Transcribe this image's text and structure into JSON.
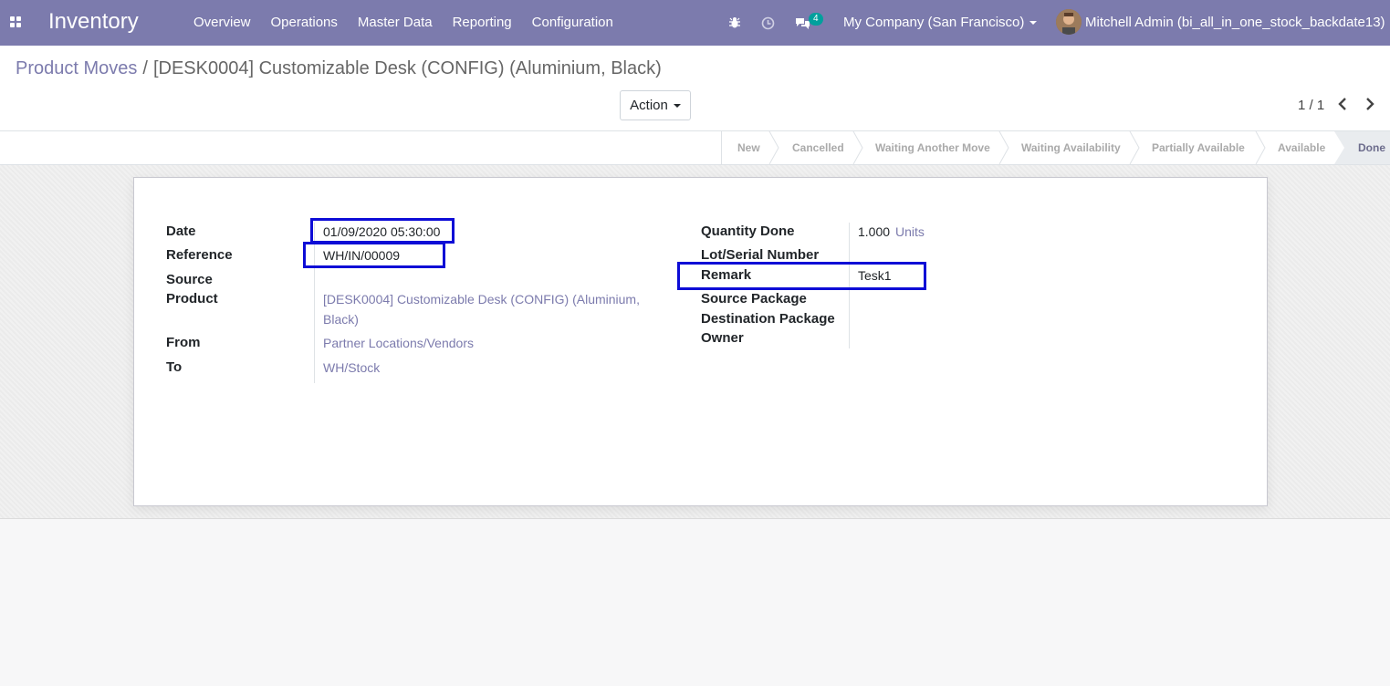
{
  "navbar": {
    "app_name": "Inventory",
    "menu": [
      "Overview",
      "Operations",
      "Master Data",
      "Reporting",
      "Configuration"
    ],
    "messages_count": "4",
    "company": "My Company (San Francisco)",
    "user": "Mitchell Admin (bi_all_in_one_stock_backdate13)",
    "bg_color": "#7c7bad"
  },
  "control": {
    "breadcrumb_parent": "Product Moves",
    "breadcrumb_separator": "/",
    "breadcrumb_current": "[DESK0004] Customizable Desk (CONFIG) (Aluminium, Black)",
    "action_label": "Action",
    "pager": "1 / 1"
  },
  "statusbar": {
    "stages": [
      "New",
      "Cancelled",
      "Waiting Another Move",
      "Waiting Availability",
      "Partially Available",
      "Available",
      "Done"
    ],
    "active": "Done"
  },
  "form": {
    "left": {
      "date_label": "Date",
      "date_value": "01/09/2020 05:30:00",
      "reference_label": "Reference",
      "reference_value": "WH/IN/00009",
      "source_label": "Source",
      "product_label": "Product",
      "product_value_line1": "[DESK0004] Customizable Desk (CONFIG) (Aluminium,",
      "product_value_line2": "Black)",
      "from_label": "From",
      "from_value": "Partner Locations/Vendors",
      "to_label": "To",
      "to_value": "WH/Stock"
    },
    "right": {
      "qty_label": "Quantity Done",
      "qty_value": "1.000",
      "qty_uom": "Units",
      "lot_label": "Lot/Serial Number",
      "remark_label": "Remark",
      "remark_value": "Tesk1",
      "src_pkg_label": "Source Package",
      "dst_pkg_label": "Destination Package",
      "owner_label": "Owner"
    }
  },
  "colors": {
    "highlight": "#0d0cd6",
    "link": "#7c7bad"
  }
}
